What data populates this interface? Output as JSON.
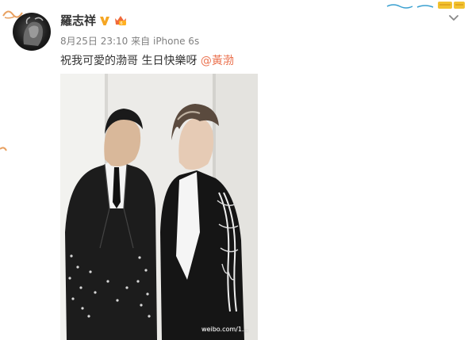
{
  "post": {
    "username": "羅志祥",
    "verified_icon": "verified-v-icon",
    "vip_icon": "vip-crown-icon",
    "date": "8月25日 23:10",
    "source_prefix": "来自",
    "device": "iPhone 6s",
    "text": "祝我可愛的渤哥 生日快樂呀 ",
    "mention": "@黃渤",
    "watermark": "weibo.com/1..."
  },
  "icons": {
    "expand": "chevron-down-icon"
  },
  "colors": {
    "mention": "#eb7350",
    "verified": "#f5a623",
    "meta": "#808080",
    "text": "#333333"
  }
}
